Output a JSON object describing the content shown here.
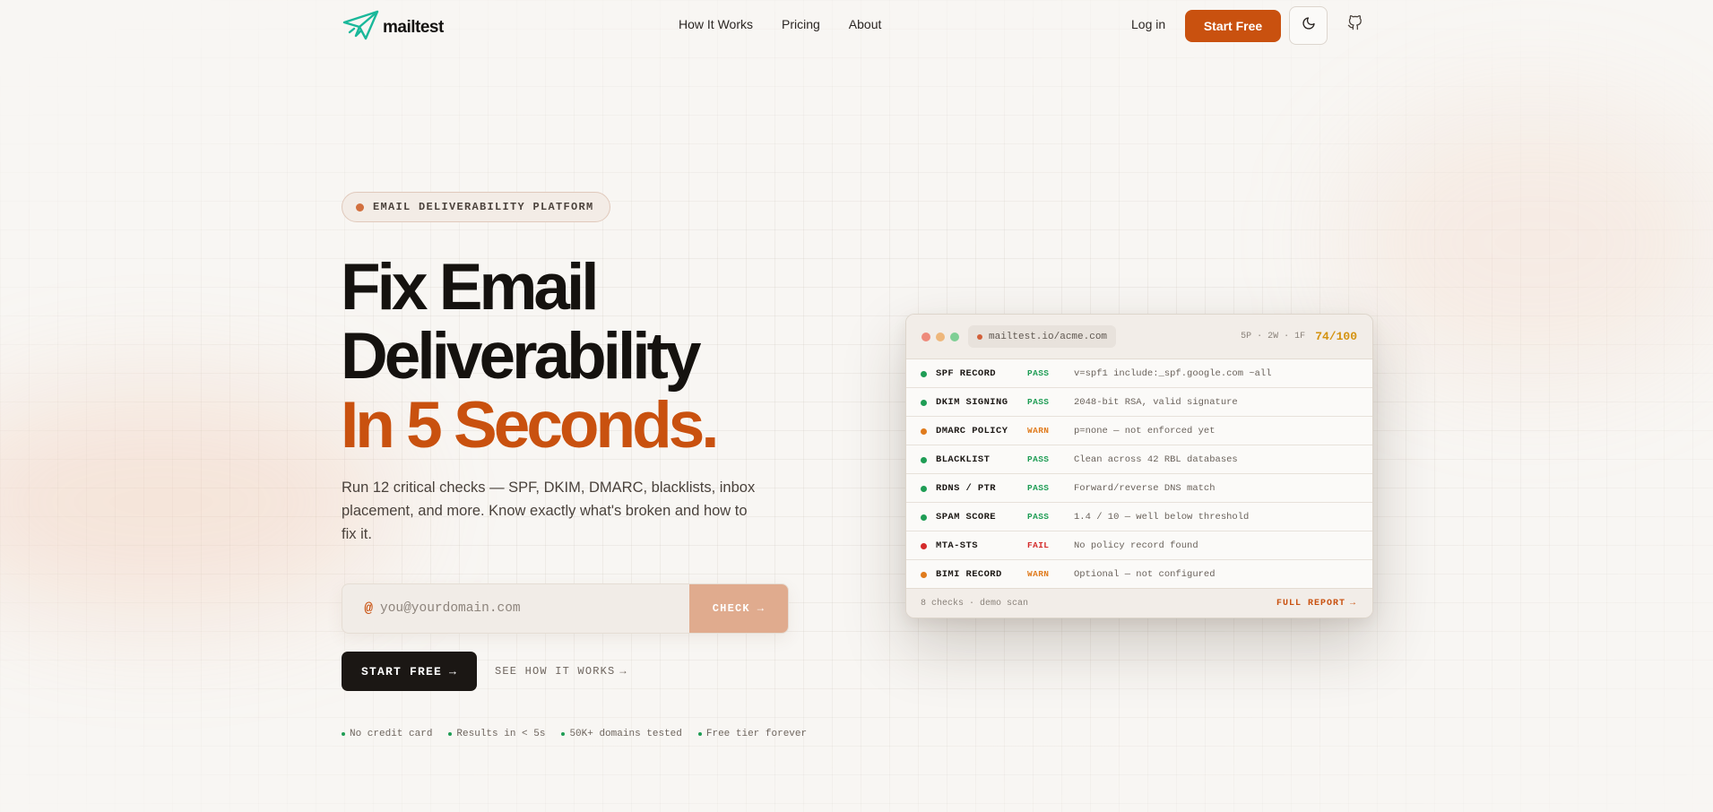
{
  "nav": {
    "logo_text": "mailtest",
    "logo_icon": "paper-plane-icon",
    "links": [
      {
        "label": "How It Works"
      },
      {
        "label": "Pricing"
      },
      {
        "label": "About"
      }
    ],
    "login_label": "Log in",
    "start_label": "Start Free",
    "theme_icon": "moon-icon",
    "github_icon": "github-icon"
  },
  "hero": {
    "badge": "EMAIL DELIVERABILITY PLATFORM",
    "headline_line1": "Fix Email",
    "headline_line2": "Deliverability",
    "headline_line3": "In 5 Seconds.",
    "subtext": "Run 12 critical checks — SPF, DKIM, DMARC, blacklists, inbox placement, and more. Know exactly what's broken and how to fix it.",
    "email_prefix": "@",
    "email_placeholder": "you@yourdomain.com",
    "check_label": "CHECK",
    "start_free_label": "START FREE",
    "how_label": "SEE HOW IT WORKS",
    "perks": [
      "No credit card",
      "Results in < 5s",
      "50K+ domains tested",
      "Free tier forever"
    ]
  },
  "demo": {
    "url": "mailtest.io/acme.com",
    "counts": "5P · 2W · 1F",
    "score": "74/100",
    "rows": [
      {
        "name": "SPF RECORD",
        "status": "PASS",
        "detail": "v=spf1 include:_spf.google.com ~all"
      },
      {
        "name": "DKIM SIGNING",
        "status": "PASS",
        "detail": "2048-bit RSA, valid signature"
      },
      {
        "name": "DMARC POLICY",
        "status": "WARN",
        "detail": "p=none — not enforced yet"
      },
      {
        "name": "BLACKLIST",
        "status": "PASS",
        "detail": "Clean across 42 RBL databases"
      },
      {
        "name": "RDNS / PTR",
        "status": "PASS",
        "detail": "Forward/reverse DNS match"
      },
      {
        "name": "SPAM SCORE",
        "status": "PASS",
        "detail": "1.4 / 10 — well below threshold"
      },
      {
        "name": "MTA-STS",
        "status": "FAIL",
        "detail": "No policy record found"
      },
      {
        "name": "BIMI RECORD",
        "status": "WARN",
        "detail": "Optional — not configured"
      }
    ],
    "footer_left": "8 checks · demo scan",
    "footer_right": "FULL REPORT"
  },
  "colors": {
    "accent": "#c9510f",
    "pass": "#1f9d55",
    "warn": "#e07b1d",
    "fail": "#d42a2a",
    "score": "#d4920f"
  }
}
